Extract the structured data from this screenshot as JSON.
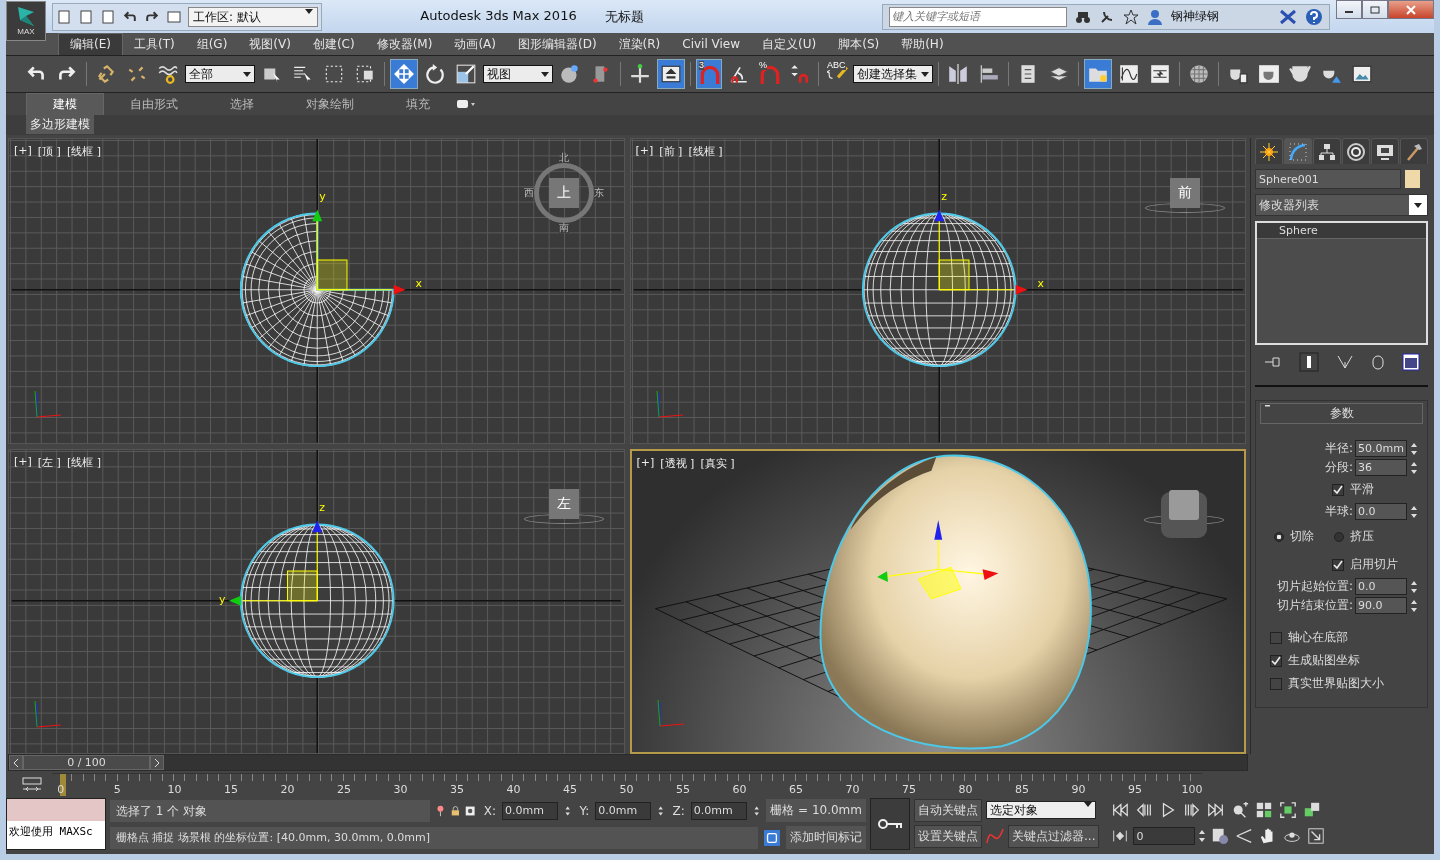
{
  "title_bar": {
    "logo": "MAX",
    "workspace": "工作区: 默认",
    "app_title": "Autodesk 3ds Max 2016",
    "doc_title": "无标题",
    "search": {
      "placeholder": "键入关键字或短语"
    },
    "user": "钢神绿钢"
  },
  "menu": [
    {
      "label": "编辑(E)",
      "selected": true
    },
    {
      "label": "工具(T)",
      "selected": false
    },
    {
      "label": "组(G)",
      "selected": false
    },
    {
      "label": "视图(V)",
      "selected": false
    },
    {
      "label": "创建(C)",
      "selected": false
    },
    {
      "label": "修改器(M)",
      "selected": false
    },
    {
      "label": "动画(A)",
      "selected": false
    },
    {
      "label": "图形编辑器(D)",
      "selected": false
    },
    {
      "label": "渲染(R)",
      "selected": false
    },
    {
      "label": "Civil View",
      "selected": false
    },
    {
      "label": "自定义(U)",
      "selected": false
    },
    {
      "label": "脚本(S)",
      "selected": false
    },
    {
      "label": "帮助(H)",
      "selected": false
    }
  ],
  "toolbar": [
    {
      "kind": "undo",
      "on": false
    },
    {
      "kind": "redo",
      "on": false
    },
    {
      "kind": "sep"
    },
    {
      "kind": "chain-link",
      "on": false
    },
    {
      "kind": "broken-chain",
      "on": false
    },
    {
      "kind": "wave-chain",
      "on": false
    },
    {
      "kind": "dropdown",
      "value": "全部"
    },
    {
      "kind": "cube-cursor",
      "on": false
    },
    {
      "kind": "list-cursor",
      "on": false
    },
    {
      "kind": "dashed-rectangle",
      "on": false
    },
    {
      "kind": "dashed-square-cube",
      "on": false
    },
    {
      "kind": "sep"
    },
    {
      "kind": "move-arrows",
      "on": true
    },
    {
      "kind": "rotate-arrow",
      "on": false
    },
    {
      "kind": "scale-box",
      "on": false
    },
    {
      "kind": "dropdown",
      "value": "视图"
    },
    {
      "kind": "sphere-cursor",
      "on": false
    },
    {
      "kind": "pivot-bar",
      "on": false
    },
    {
      "kind": "sep"
    },
    {
      "kind": "axis-cross",
      "on": false
    },
    {
      "kind": "up-arrow-box",
      "on": true
    },
    {
      "kind": "sep"
    },
    {
      "kind": "magnet",
      "label": "3",
      "on": true
    },
    {
      "kind": "angle-magnet",
      "on": false
    },
    {
      "kind": "magnet",
      "label": "%",
      "on": false
    },
    {
      "kind": "spinner-magnet",
      "on": false
    },
    {
      "kind": "sep"
    },
    {
      "kind": "braces-pencil",
      "label": "ABC",
      "on": false
    },
    {
      "kind": "dropdown",
      "value": "创建选择集"
    },
    {
      "kind": "sep"
    },
    {
      "kind": "mirror",
      "on": false
    },
    {
      "kind": "align-bars",
      "on": false
    },
    {
      "kind": "sep"
    },
    {
      "kind": "list-sheet",
      "on": false
    },
    {
      "kind": "layer-stack",
      "on": false
    },
    {
      "kind": "sep"
    },
    {
      "kind": "folder-bulb",
      "on": true
    },
    {
      "kind": "curve-graph",
      "on": false
    },
    {
      "kind": "schematic-box",
      "on": false
    },
    {
      "kind": "sep"
    },
    {
      "kind": "checker-sphere",
      "on": false
    },
    {
      "kind": "sep"
    },
    {
      "kind": "teapot-sheet",
      "on": false
    },
    {
      "kind": "teapot-box",
      "on": false
    },
    {
      "kind": "teapot",
      "on": false
    },
    {
      "kind": "teapot-lamp",
      "on": false
    },
    {
      "kind": "picture-window",
      "on": false
    }
  ],
  "ribbon": {
    "tabs": [
      {
        "label": "建模",
        "selected": true
      },
      {
        "label": "自由形式",
        "selected": false
      },
      {
        "label": "选择",
        "selected": false
      },
      {
        "label": "对象绘制",
        "selected": false
      },
      {
        "label": "填充",
        "selected": false
      }
    ],
    "panel": "多边形建模"
  },
  "viewports": [
    {
      "kind": "top",
      "active": false,
      "labels": [
        "[+]",
        "[顶 ]",
        "[线框 ]"
      ],
      "axes": [
        "y",
        "x"
      ],
      "viewcube": {
        "face": "上",
        "compass": [
          "北",
          "西",
          "东",
          "南"
        ]
      }
    },
    {
      "kind": "front",
      "active": false,
      "labels": [
        "[+]",
        "[前 ]",
        "[线框 ]"
      ],
      "axes": [
        "z",
        "x"
      ],
      "viewcube": {
        "face": "前"
      }
    },
    {
      "kind": "left",
      "active": false,
      "labels": [
        "[+]",
        "[左 ]",
        "[线框 ]"
      ],
      "axes": [
        "z",
        "y"
      ],
      "viewcube": {
        "face": "左"
      }
    },
    {
      "kind": "perspective",
      "active": true,
      "labels": [
        "[+]",
        "[透视 ]",
        "[真实 ]"
      ]
    }
  ],
  "command_panel": {
    "tabs": [
      {
        "kind": "sun",
        "selected": false
      },
      {
        "kind": "curve",
        "selected": true
      },
      {
        "kind": "hierarchy",
        "selected": false
      },
      {
        "kind": "rings",
        "selected": false
      },
      {
        "kind": "monitor",
        "selected": false
      },
      {
        "kind": "hammer",
        "selected": false
      }
    ],
    "object_name": "Sphere001",
    "color": "#f0d9a8",
    "modifier_list": "修改器列表",
    "stack": [
      "Sphere"
    ],
    "rollout": "参数",
    "params": [
      {
        "kind": "spinner",
        "label": "半径:",
        "value": "50.0mm"
      },
      {
        "kind": "spinner",
        "label": "分段:",
        "value": "36"
      },
      {
        "kind": "checkbox",
        "label": "平滑",
        "checked": true
      },
      {
        "kind": "spinner",
        "label": "半球:",
        "value": "0.0"
      },
      {
        "kind": "radios",
        "options": [
          {
            "label": "切除",
            "selected": true
          },
          {
            "label": "挤压",
            "selected": false
          }
        ]
      },
      {
        "kind": "checkbox",
        "label": "启用切片",
        "checked": true
      },
      {
        "kind": "spinner",
        "label": "切片起始位置:",
        "value": "0.0"
      },
      {
        "kind": "spinner",
        "label": "切片结束位置:",
        "value": "90.0"
      }
    ],
    "options": [
      {
        "label": "轴心在底部",
        "checked": false
      },
      {
        "label": "生成贴图坐标",
        "checked": true
      },
      {
        "label": "真实世界贴图大小",
        "checked": false
      }
    ]
  },
  "timeline": {
    "slider": "0 / 100",
    "level": 0,
    "ticks": [
      "0",
      "5",
      "10",
      "15",
      "20",
      "25",
      "30",
      "35",
      "40",
      "45",
      "50",
      "55",
      "60",
      "65",
      "70",
      "75",
      "80",
      "85",
      "90",
      "95",
      "100"
    ]
  },
  "status": {
    "script": "欢迎使用 MAXSc",
    "message": "选择了 1 个 对象",
    "prompt": "栅格点 捕捉 场景根 的坐标位置:  [40.0mm, 30.0mm, 0.0mm]",
    "coords": [
      {
        "axis": "X:",
        "value": "0.0mm"
      },
      {
        "axis": "Y:",
        "value": "0.0mm"
      },
      {
        "axis": "Z:",
        "value": "0.0mm"
      }
    ],
    "grid": "栅格 = 10.0mm",
    "time_tag": "添加时间标记",
    "auto_key": "自动关键点",
    "set_key": "设置关键点",
    "key_target": "选定对象",
    "key_filters": "关键点过滤器...",
    "frame": "0"
  }
}
